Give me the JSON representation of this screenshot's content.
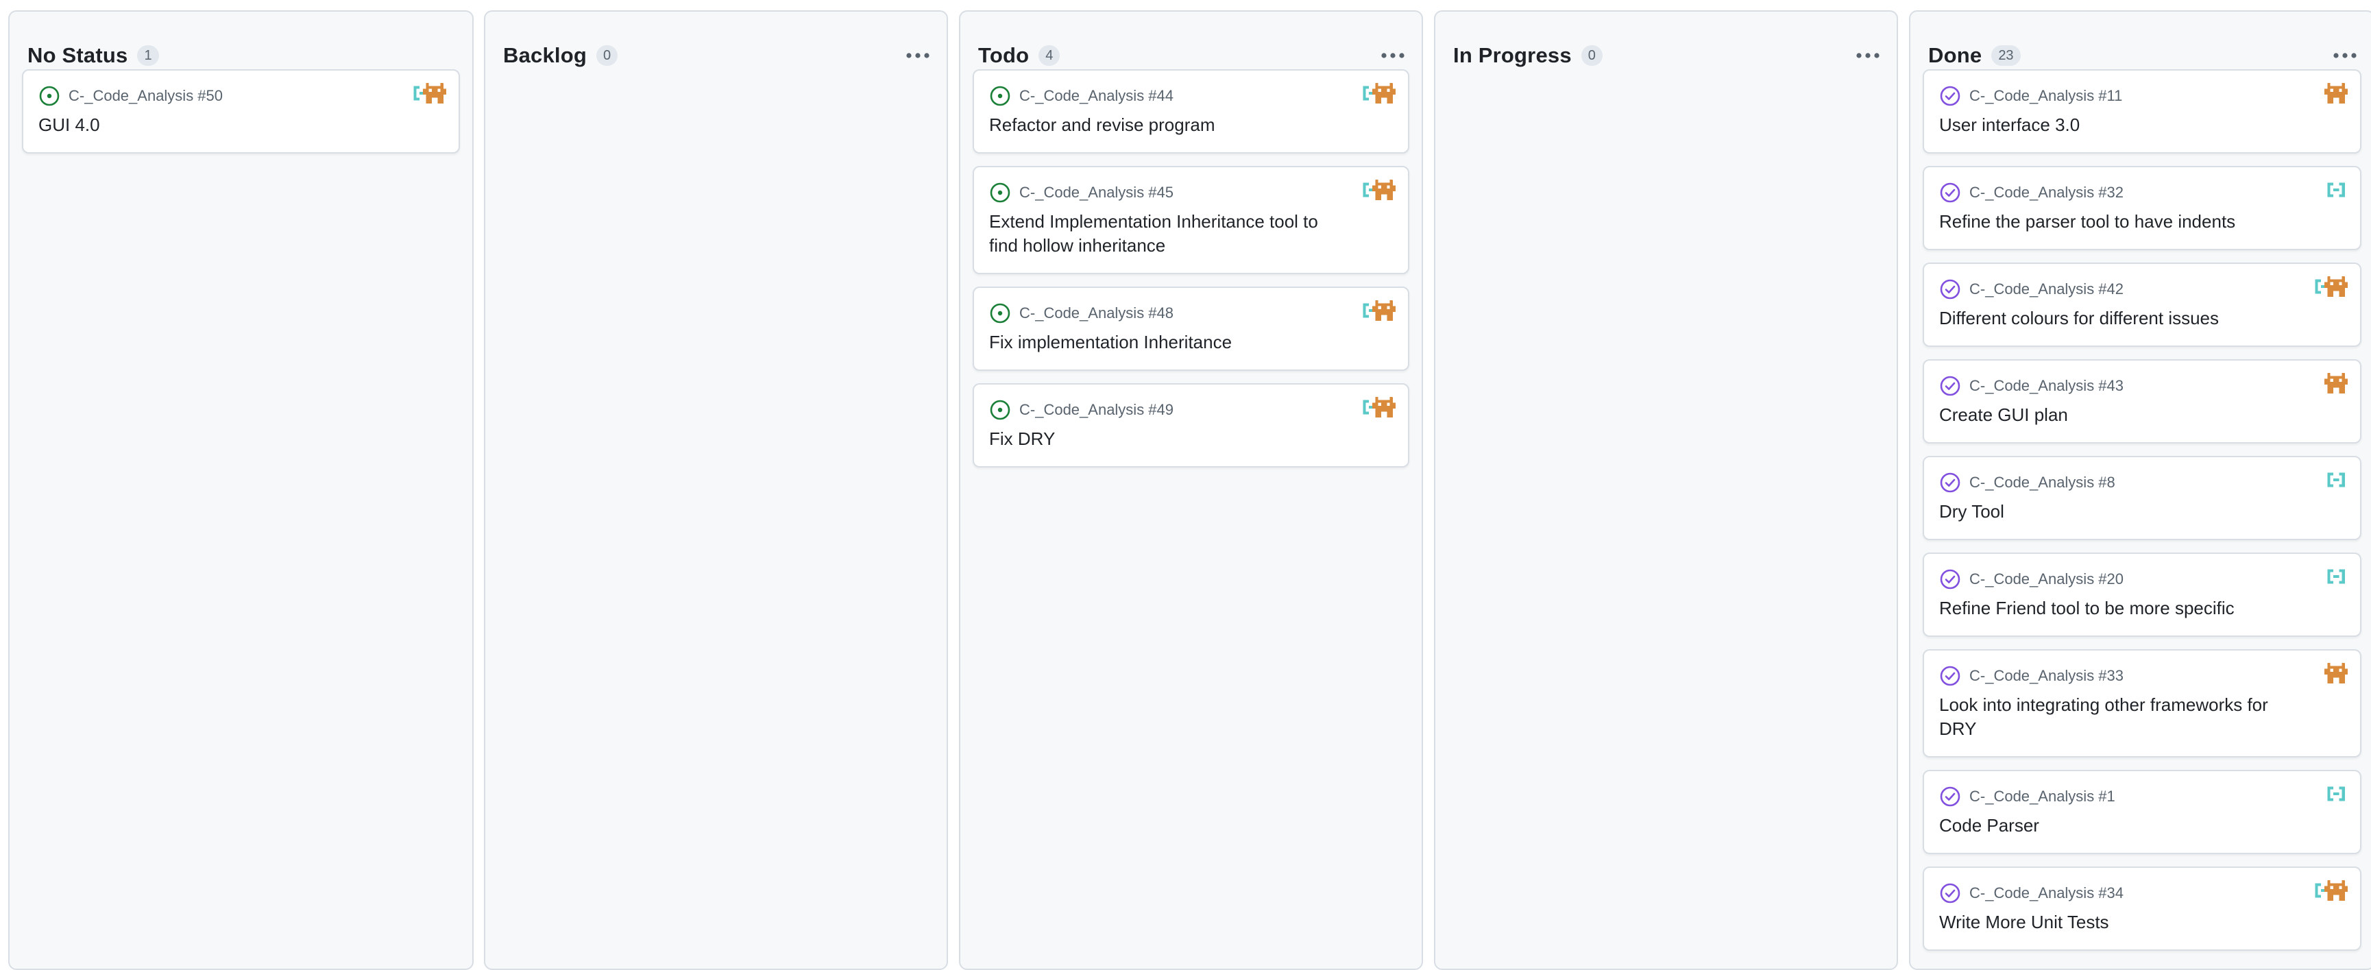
{
  "colors": {
    "open_status": "#1a7f37",
    "done_status": "#8250df",
    "avatar_teal": "#5cc9c9",
    "avatar_orange": "#d98a3a"
  },
  "columns": [
    {
      "title": "No Status",
      "count": "1",
      "cards": [
        {
          "ref": "C-_Code_Analysis #50",
          "title": "GUI 4.0",
          "status": "open",
          "avatars": [
            "teal-avatar",
            "orange-avatar"
          ]
        }
      ]
    },
    {
      "title": "Backlog",
      "count": "0",
      "cards": []
    },
    {
      "title": "Todo",
      "count": "4",
      "cards": [
        {
          "ref": "C-_Code_Analysis #44",
          "title": "Refactor and revise program",
          "status": "open",
          "avatars": [
            "teal-avatar",
            "orange-avatar"
          ]
        },
        {
          "ref": "C-_Code_Analysis #45",
          "title": "Extend Implementation Inheritance tool to find hollow inheritance",
          "status": "open",
          "avatars": [
            "teal-avatar",
            "orange-avatar"
          ]
        },
        {
          "ref": "C-_Code_Analysis #48",
          "title": "Fix implementation Inheritance",
          "status": "open",
          "avatars": [
            "teal-avatar",
            "orange-avatar"
          ]
        },
        {
          "ref": "C-_Code_Analysis #49",
          "title": "Fix DRY",
          "status": "open",
          "avatars": [
            "teal-avatar",
            "orange-avatar"
          ]
        }
      ]
    },
    {
      "title": "In Progress",
      "count": "0",
      "cards": []
    },
    {
      "title": "Done",
      "count": "23",
      "cards": [
        {
          "ref": "C-_Code_Analysis #11",
          "title": "User interface 3.0",
          "status": "done",
          "avatars": [
            "orange-avatar"
          ]
        },
        {
          "ref": "C-_Code_Analysis #32",
          "title": "Refine the parser tool to have indents",
          "status": "done",
          "avatars": [
            "teal-avatar"
          ]
        },
        {
          "ref": "C-_Code_Analysis #42",
          "title": "Different colours for different issues",
          "status": "done",
          "avatars": [
            "teal-avatar",
            "orange-avatar"
          ]
        },
        {
          "ref": "C-_Code_Analysis #43",
          "title": "Create GUI plan",
          "status": "done",
          "avatars": [
            "orange-avatar"
          ]
        },
        {
          "ref": "C-_Code_Analysis #8",
          "title": "Dry Tool",
          "status": "done",
          "avatars": [
            "teal-avatar"
          ]
        },
        {
          "ref": "C-_Code_Analysis #20",
          "title": "Refine Friend tool to be more specific",
          "status": "done",
          "avatars": [
            "teal-avatar"
          ]
        },
        {
          "ref": "C-_Code_Analysis #33",
          "title": "Look into integrating other frameworks for DRY",
          "status": "done",
          "avatars": [
            "orange-avatar"
          ]
        },
        {
          "ref": "C-_Code_Analysis #1",
          "title": "Code Parser",
          "status": "done",
          "avatars": [
            "teal-avatar"
          ]
        },
        {
          "ref": "C-_Code_Analysis #34",
          "title": "Write More Unit Tests",
          "status": "done",
          "avatars": [
            "teal-avatar",
            "orange-avatar"
          ]
        }
      ]
    }
  ]
}
